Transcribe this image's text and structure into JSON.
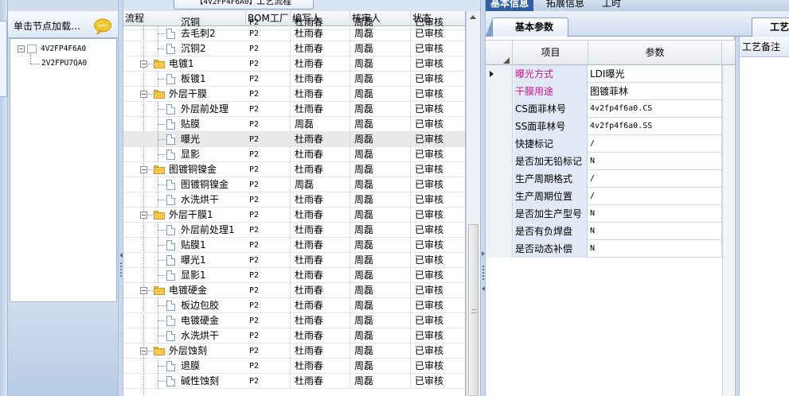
{
  "left_panel": {
    "load_label": "单击节点加载…",
    "tree": [
      {
        "label": "4V2FP4F6A0"
      },
      {
        "label": "2V2FPU7QA0"
      }
    ]
  },
  "flow_grid": {
    "title_code": "【4V2FP4F6A0】",
    "title_suffix": "工艺流程",
    "columns": [
      "流程",
      "BOM工厂",
      "编写人",
      "核审人",
      "状态"
    ],
    "top_partial_row": [
      "沉铜",
      "P2",
      "杜雨春",
      "周磊",
      "已审核"
    ],
    "rows": [
      {
        "name": "去毛刺2",
        "factory": "P2",
        "writer": "杜雨春",
        "reviewer": "周磊",
        "status": "已审核"
      },
      {
        "name": "沉铜2",
        "factory": "P2",
        "writer": "杜雨春",
        "reviewer": "周磊",
        "status": "已审核"
      },
      {
        "name": "电镀1",
        "factory": "P2",
        "writer": "杜雨春",
        "reviewer": "周磊",
        "status": "已审核"
      },
      {
        "name": "板镀1",
        "factory": "P2",
        "writer": "杜雨春",
        "reviewer": "周磊",
        "status": "已审核"
      },
      {
        "name": "外层干膜",
        "factory": "P2",
        "writer": "杜雨春",
        "reviewer": "周磊",
        "status": "已审核"
      },
      {
        "name": "外层前处理",
        "factory": "P2",
        "writer": "杜雨春",
        "reviewer": "周磊",
        "status": "已审核"
      },
      {
        "name": "贴膜",
        "factory": "P2",
        "writer": "周磊",
        "reviewer": "周磊",
        "status": "已审核"
      },
      {
        "name": "曝光",
        "factory": "P2",
        "writer": "杜雨春",
        "reviewer": "周磊",
        "status": "已审核"
      },
      {
        "name": "显影",
        "factory": "P2",
        "writer": "杜雨春",
        "reviewer": "周磊",
        "status": "已审核"
      },
      {
        "name": "图镀铜镍金",
        "factory": "P2",
        "writer": "杜雨春",
        "reviewer": "周磊",
        "status": "已审核"
      },
      {
        "name": "图镀铜镍金",
        "factory": "P2",
        "writer": "周磊",
        "reviewer": "周磊",
        "status": "已审核"
      },
      {
        "name": "水洗烘干",
        "factory": "P2",
        "writer": "杜雨春",
        "reviewer": "周磊",
        "status": "已审核"
      },
      {
        "name": "外层干膜1",
        "factory": "P2",
        "writer": "杜雨春",
        "reviewer": "周磊",
        "status": "已审核"
      },
      {
        "name": "外层前处理1",
        "factory": "P2",
        "writer": "杜雨春",
        "reviewer": "周磊",
        "status": "已审核"
      },
      {
        "name": "贴膜1",
        "factory": "P2",
        "writer": "杜雨春",
        "reviewer": "周磊",
        "status": "已审核"
      },
      {
        "name": "曝光1",
        "factory": "P2",
        "writer": "杜雨春",
        "reviewer": "周磊",
        "status": "已审核"
      },
      {
        "name": "显影1",
        "factory": "P2",
        "writer": "杜雨春",
        "reviewer": "周磊",
        "status": "已审核"
      },
      {
        "name": "电镀硬金",
        "factory": "P2",
        "writer": "杜雨春",
        "reviewer": "周磊",
        "status": "已审核"
      },
      {
        "name": "板边包胶",
        "factory": "P2",
        "writer": "杜雨春",
        "reviewer": "周磊",
        "status": "已审核"
      },
      {
        "name": "电镀硬金",
        "factory": "P2",
        "writer": "杜雨春",
        "reviewer": "周磊",
        "status": "已审核"
      },
      {
        "name": "水洗烘干",
        "factory": "P2",
        "writer": "杜雨春",
        "reviewer": "周磊",
        "status": "已审核"
      },
      {
        "name": "外层蚀刻",
        "factory": "P2",
        "writer": "杜雨春",
        "reviewer": "周磊",
        "status": "已审核"
      },
      {
        "name": "退膜",
        "factory": "P2",
        "writer": "杜雨春",
        "reviewer": "周磊",
        "status": "已审核"
      },
      {
        "name": "碱性蚀刻",
        "factory": "P2",
        "writer": "杜雨春",
        "reviewer": "周磊",
        "status": "已审核"
      }
    ]
  },
  "right_panel": {
    "tabs": [
      "基本信息",
      "拓展信息",
      "工时"
    ],
    "sub_tab": "基本参数",
    "process_tab": "工艺",
    "columns": [
      "项目",
      "参数"
    ],
    "params": [
      {
        "key": "曝光方式",
        "value": "LDI曝光",
        "highlight": true
      },
      {
        "key": "干膜用途",
        "value": "图镀菲林",
        "highlight": true
      },
      {
        "key": "CS面菲林号",
        "value": "4v2fp4f6a0.CS",
        "highlight": false
      },
      {
        "key": "SS面菲林号",
        "value": "4v2fp4f6a0.SS",
        "highlight": false
      },
      {
        "key": "快捷标记",
        "value": "/",
        "highlight": false
      },
      {
        "key": "是否加无铅标记",
        "value": "N",
        "highlight": false
      },
      {
        "key": "生产周期格式",
        "value": "/",
        "highlight": false
      },
      {
        "key": "生产周期位置",
        "value": "/",
        "highlight": false
      },
      {
        "key": "是否加生产型号",
        "value": "N",
        "highlight": false
      },
      {
        "key": "是否有负焊盘",
        "value": "N",
        "highlight": false
      },
      {
        "key": "是否动态补偿",
        "value": "N",
        "highlight": false
      }
    ],
    "note_header": "工艺备注"
  }
}
